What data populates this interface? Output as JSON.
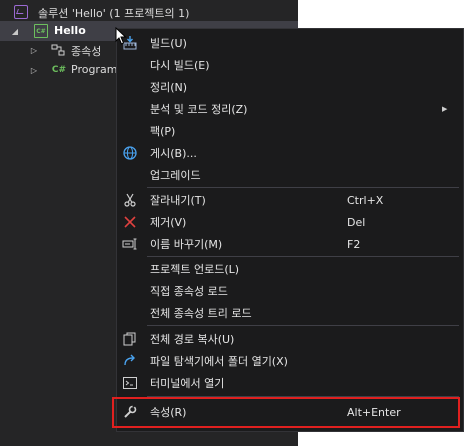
{
  "explorer": {
    "solution": "솔루션 'Hello' (1 프로젝트의 1)",
    "project": "Hello",
    "project_icon_text": "C#",
    "dependencies": "종속성",
    "program_icon_text": "C#",
    "program": "Program"
  },
  "context_menu": {
    "items": [
      {
        "label": "빌드(U)",
        "shortcut": "",
        "icon": "build-icon"
      },
      {
        "label": "다시 빌드(E)",
        "shortcut": "",
        "icon": ""
      },
      {
        "label": "정리(N)",
        "shortcut": "",
        "icon": ""
      },
      {
        "label": "분석 및 코드 정리(Z)",
        "shortcut": "",
        "icon": "",
        "submenu": true
      },
      {
        "label": "팩(P)",
        "shortcut": "",
        "icon": ""
      },
      {
        "label": "게시(B)...",
        "shortcut": "",
        "icon": "globe-icon"
      },
      {
        "label": "업그레이드",
        "shortcut": "",
        "icon": ""
      },
      {
        "label": "잘라내기(T)",
        "shortcut": "Ctrl+X",
        "icon": "scissors-icon"
      },
      {
        "label": "제거(V)",
        "shortcut": "Del",
        "icon": "delete-icon"
      },
      {
        "label": "이름 바꾸기(M)",
        "shortcut": "F2",
        "icon": "rename-icon"
      },
      {
        "label": "프로젝트 언로드(L)",
        "shortcut": "",
        "icon": ""
      },
      {
        "label": "직접 종속성 로드",
        "shortcut": "",
        "icon": ""
      },
      {
        "label": "전체 종속성 트리 로드",
        "shortcut": "",
        "icon": ""
      },
      {
        "label": "전체 경로 복사(U)",
        "shortcut": "",
        "icon": "copy-icon"
      },
      {
        "label": "파일 탐색기에서 폴더 열기(X)",
        "shortcut": "",
        "icon": "refresh-arrow-icon"
      },
      {
        "label": "터미널에서 열기",
        "shortcut": "",
        "icon": "terminal-icon"
      },
      {
        "label": "속성(R)",
        "shortcut": "Alt+Enter",
        "icon": "wrench-icon"
      }
    ]
  },
  "colors": {
    "highlight_border": "#e0201f",
    "menu_background": "#1b1b1c",
    "selected_row": "#3f3f46"
  }
}
